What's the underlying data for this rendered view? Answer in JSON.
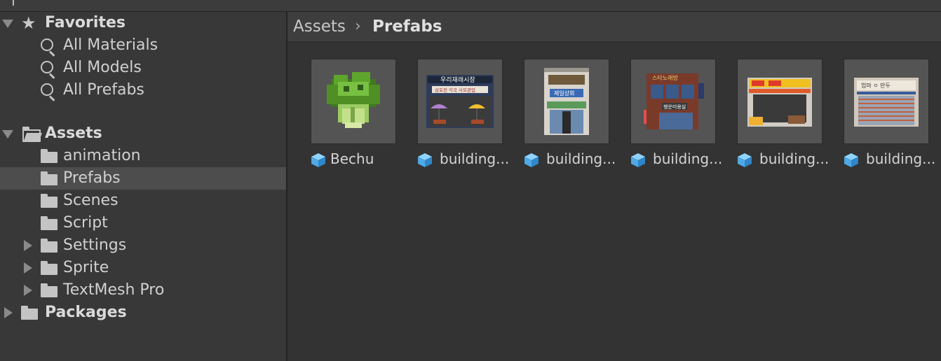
{
  "tree": {
    "favorites": {
      "label": "Favorites",
      "items": [
        {
          "label": "All Materials",
          "icon": "search-icon"
        },
        {
          "label": "All Models",
          "icon": "search-icon"
        },
        {
          "label": "All Prefabs",
          "icon": "search-icon"
        }
      ]
    },
    "assets": {
      "label": "Assets",
      "items": [
        {
          "label": "animation",
          "expandable": false
        },
        {
          "label": "Prefabs",
          "expandable": false,
          "selected": true
        },
        {
          "label": "Scenes",
          "expandable": false
        },
        {
          "label": "Script",
          "expandable": false
        },
        {
          "label": "Settings",
          "expandable": true
        },
        {
          "label": "Sprite",
          "expandable": true
        },
        {
          "label": "TextMesh Pro",
          "expandable": true
        }
      ]
    },
    "packages": {
      "label": "Packages"
    }
  },
  "breadcrumb": {
    "parent": "Assets",
    "separator_icon": "chevron-right-icon",
    "current": "Prefabs"
  },
  "assets_grid": [
    {
      "name": "Bechu",
      "icon": "prefab-cube-icon"
    },
    {
      "name": "building...",
      "icon": "prefab-cube-icon",
      "sign": "우리재래시장",
      "sub": "삼포전 각국 사모관업"
    },
    {
      "name": "building...",
      "icon": "prefab-cube-icon",
      "sign": "제일상회"
    },
    {
      "name": "building...",
      "icon": "prefab-cube-icon",
      "sign": "스타노래방",
      "sub": "행운미용실"
    },
    {
      "name": "building...",
      "icon": "prefab-cube-icon"
    },
    {
      "name": "building...",
      "icon": "prefab-cube-icon",
      "sign": "엄마 ㅇ 만두"
    }
  ],
  "colors": {
    "background": "#383838",
    "content": "#333333",
    "selected_row": "#4d4d4d",
    "thumb": "#545454",
    "prefab_icon": "#4fa9e6"
  }
}
